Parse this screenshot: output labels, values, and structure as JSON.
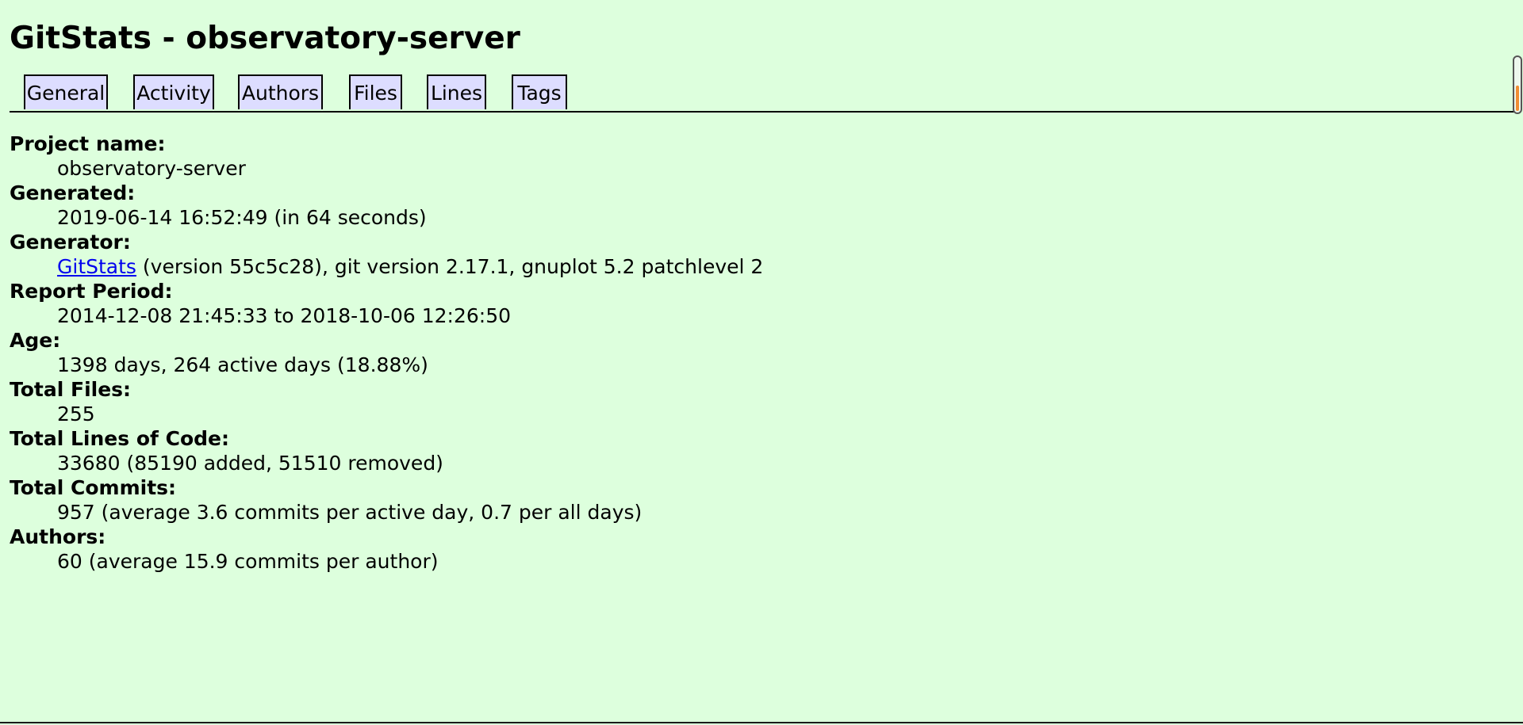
{
  "title": "GitStats - observatory-server",
  "nav": {
    "tabs": [
      "General",
      "Activity",
      "Authors",
      "Files",
      "Lines",
      "Tags"
    ]
  },
  "general": {
    "project_name_label": "Project name:",
    "project_name": "observatory-server",
    "generated_label": "Generated:",
    "generated": "2019-06-14 16:52:49 (in 64 seconds)",
    "generator_label": "Generator:",
    "generator_link": "GitStats",
    "generator_rest": " (version 55c5c28), git version 2.17.1, gnuplot 5.2 patchlevel 2",
    "report_period_label": "Report Period:",
    "report_period": "2014-12-08 21:45:33 to 2018-10-06 12:26:50",
    "age_label": "Age:",
    "age": "1398 days, 264 active days (18.88%)",
    "total_files_label": "Total Files:",
    "total_files": "255",
    "total_loc_label": "Total Lines of Code:",
    "total_loc": "33680 (85190 added, 51510 removed)",
    "total_commits_label": "Total Commits:",
    "total_commits": "957 (average 3.6 commits per active day, 0.7 per all days)",
    "authors_label": "Authors:",
    "authors": "60 (average 15.9 commits per author)"
  }
}
